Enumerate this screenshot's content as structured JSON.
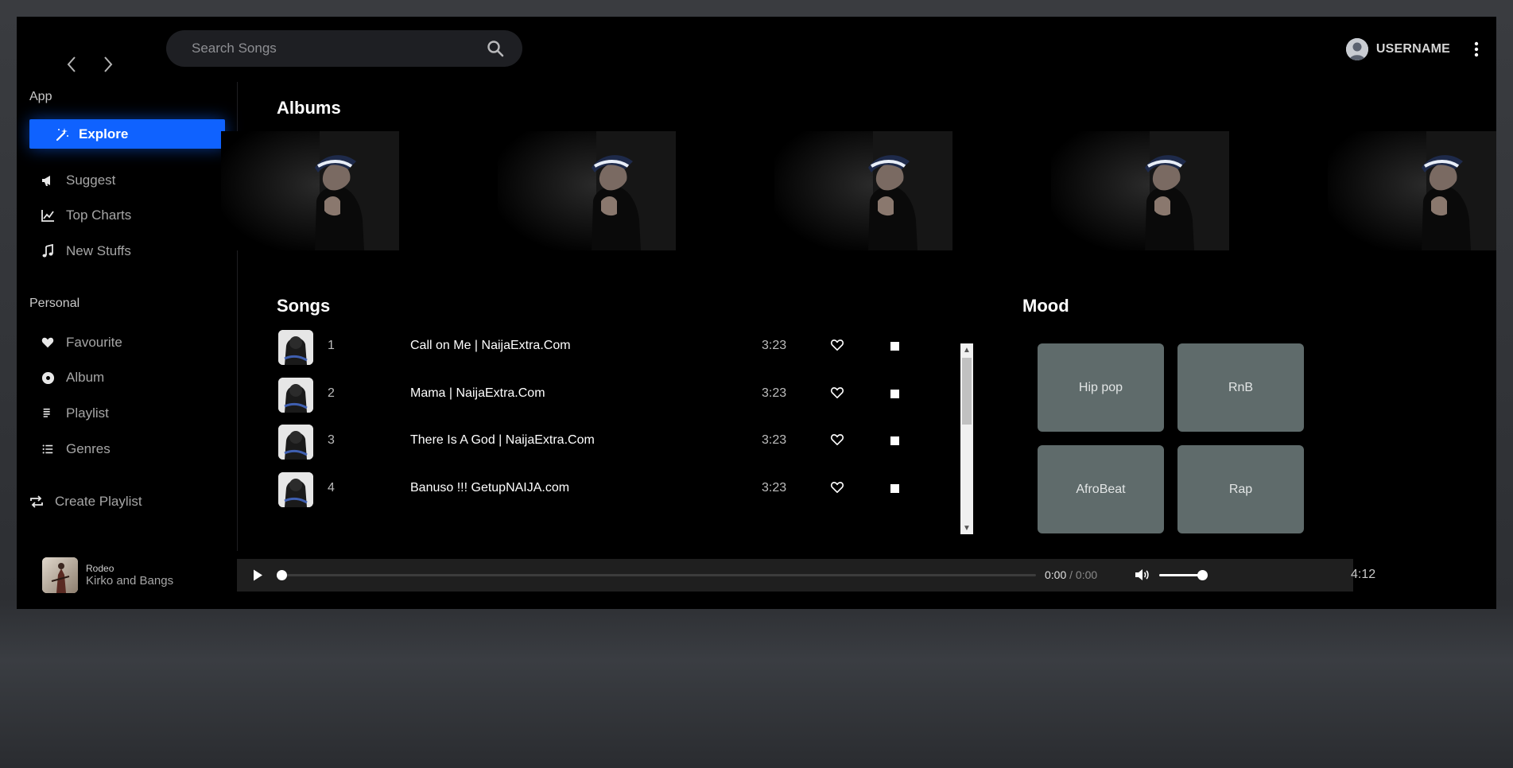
{
  "header": {
    "search_placeholder": "Search Songs",
    "username": "USERNAME"
  },
  "sidebar": {
    "section_app": "App",
    "explore_label": "Explore",
    "items_app": [
      {
        "label": "Suggest",
        "icon": "megaphone-icon"
      },
      {
        "label": "Top Charts",
        "icon": "chart-icon"
      },
      {
        "label": "New Stuffs",
        "icon": "music-note-icon"
      }
    ],
    "section_personal": "Personal",
    "items_personal": [
      {
        "label": "Favourite",
        "icon": "heart-icon"
      },
      {
        "label": "Album",
        "icon": "disc-icon"
      },
      {
        "label": "Playlist",
        "icon": "list-icon"
      },
      {
        "label": "Genres",
        "icon": "list-ordered-icon"
      }
    ],
    "create_playlist": "Create Playlist"
  },
  "main": {
    "albums_heading": "Albums",
    "songs_heading": "Songs",
    "mood_heading": "Mood",
    "songs": [
      {
        "num": "1",
        "title": "Call on Me | NaijaExtra.Com",
        "duration": "3:23"
      },
      {
        "num": "2",
        "title": "Mama | NaijaExtra.Com",
        "duration": "3:23"
      },
      {
        "num": "3",
        "title": "There Is A God | NaijaExtra.Com",
        "duration": "3:23"
      },
      {
        "num": "4",
        "title": "Banuso !!! GetupNAIJA.com",
        "duration": "3:23"
      }
    ],
    "moods": [
      "Hip pop",
      "RnB",
      "AfroBeat",
      "Rap"
    ]
  },
  "player": {
    "track_name": "Rodeo",
    "artist": "Kirko and Bangs",
    "current_time": "0:00",
    "separator": " / ",
    "duration": "0:00",
    "total_time": "4:12",
    "progress": 0,
    "volume": 0.9
  },
  "colors": {
    "accent": "#0f62ff",
    "mood_tile": "#5f6b6b",
    "background": "#000000"
  }
}
